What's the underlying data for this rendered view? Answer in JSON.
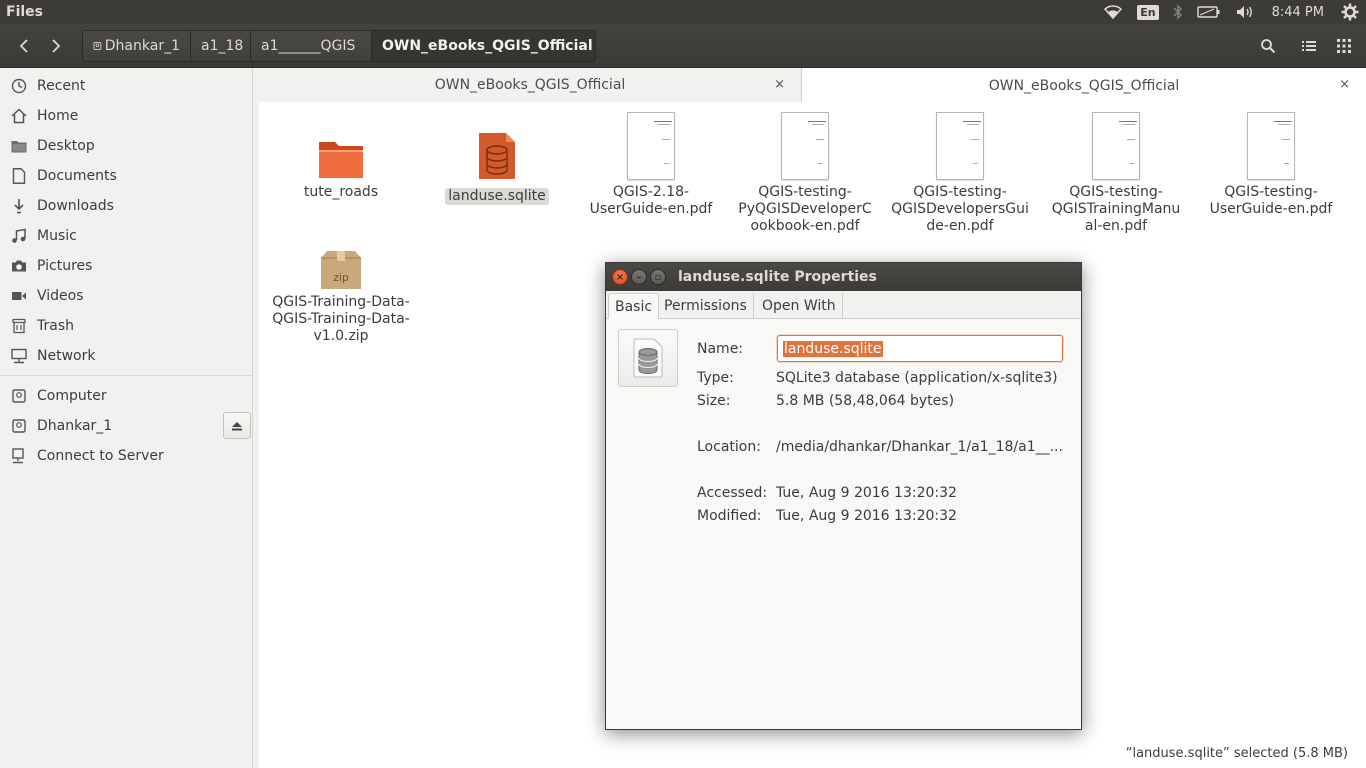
{
  "top_panel": {
    "app_title": "Files",
    "keyboard_layout": "En",
    "clock": "8:44 PM",
    "icons": [
      "wifi-icon",
      "keyboard-layout-icon",
      "bluetooth-icon",
      "battery-icon",
      "volume-icon",
      "settings-gear-icon"
    ]
  },
  "header": {
    "breadcrumbs": [
      "Dhankar_1",
      "a1_18",
      "a1______QGIS",
      "OWN_eBooks_QGIS_Official"
    ],
    "icons": [
      "back-arrow-icon",
      "forward-arrow-icon",
      "drive-icon",
      "search-icon",
      "list-view-icon",
      "grid-view-icon"
    ]
  },
  "sidebar": {
    "items": [
      {
        "label": "Recent",
        "icon": "clock-icon"
      },
      {
        "label": "Home",
        "icon": "home-icon"
      },
      {
        "label": "Desktop",
        "icon": "folder-icon"
      },
      {
        "label": "Documents",
        "icon": "document-icon"
      },
      {
        "label": "Downloads",
        "icon": "download-icon"
      },
      {
        "label": "Music",
        "icon": "music-icon"
      },
      {
        "label": "Pictures",
        "icon": "camera-icon"
      },
      {
        "label": "Videos",
        "icon": "video-icon"
      },
      {
        "label": "Trash",
        "icon": "trash-icon"
      },
      {
        "label": "Network",
        "icon": "network-icon"
      }
    ],
    "devices": [
      {
        "label": "Computer",
        "icon": "drive-icon"
      },
      {
        "label": "Dhankar_1",
        "icon": "drive-icon"
      },
      {
        "label": "Connect to Server",
        "icon": "server-icon"
      }
    ]
  },
  "tabs": [
    {
      "label": "OWN_eBooks_QGIS_Official",
      "close": "×"
    },
    {
      "label": "OWN_eBooks_QGIS_Official",
      "close": "×"
    }
  ],
  "files": [
    {
      "lines": [
        "tute_roads"
      ],
      "type": "folder"
    },
    {
      "lines": [
        "landuse.sqlite"
      ],
      "type": "sqlite",
      "selected": true
    },
    {
      "lines": [
        "QGIS-2.18-",
        "UserGuide-en.pdf"
      ],
      "type": "pdf"
    },
    {
      "lines": [
        "QGIS-testing-",
        "PyQGISDeveloperC",
        "ookbook-en.pdf"
      ],
      "type": "pdf"
    },
    {
      "lines": [
        "QGIS-testing-",
        "QGISDevelopersGui",
        "de-en.pdf"
      ],
      "type": "pdf"
    },
    {
      "lines": [
        "QGIS-testing-",
        "QGISTrainingManu",
        "al-en.pdf"
      ],
      "type": "pdf"
    },
    {
      "lines": [
        "QGIS-testing-",
        "UserGuide-en.pdf"
      ],
      "type": "pdf"
    },
    {
      "lines": [
        "QGIS-Training-Data-",
        "QGIS-Training-Data-",
        "v1.0.zip"
      ],
      "type": "zip",
      "badge": "zip"
    }
  ],
  "status_bar": "“landuse.sqlite” selected  (5.8 MB)",
  "dialog": {
    "title": "landuse.sqlite Properties",
    "tabs": [
      "Basic",
      "Permissions",
      "Open With"
    ],
    "name_label": "Name:",
    "name_value": "landuse.sqlite",
    "type_label": "Type:",
    "type_value": "SQLite3 database (application/x-sqlite3)",
    "size_label": "Size:",
    "size_value": "5.8 MB (58,48,064 bytes)",
    "location_label": "Location:",
    "location_value": "/media/dhankar/Dhankar_1/a1_18/a1__...",
    "accessed_label": "Accessed:",
    "accessed_value": "Tue, Aug  9 2016 13:20:32",
    "modified_label": "Modified:",
    "modified_value": "Tue, Aug  9 2016 13:20:32"
  },
  "colors": {
    "accent": "#e0733e",
    "panel": "#3c3b37",
    "sqlite_icon": "#d35a2c",
    "folder": "#ef6c3c"
  }
}
